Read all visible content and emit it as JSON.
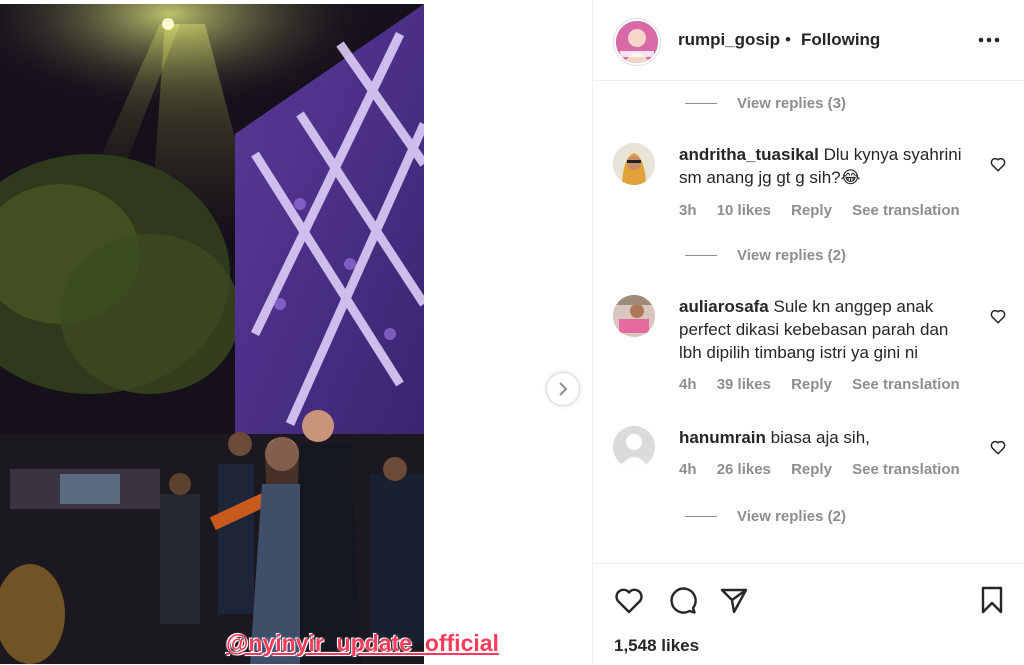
{
  "post": {
    "watermark": "@nyinyir_update_official"
  },
  "header": {
    "username": "rumpi_gosip",
    "separator": "•",
    "follow_status": "Following",
    "more_icon": "more-horizontal-icon"
  },
  "comments": {
    "view_replies": [
      {
        "label": "View replies (3)"
      },
      {
        "label": "View replies (2)"
      },
      {
        "label": "View replies (2)"
      }
    ],
    "items": [
      {
        "username": "andritha_tuasikal",
        "text": "Dlu kynya syahrini sm anang jg gt g sih?😂",
        "time": "3h",
        "likes": "10 likes",
        "reply": "Reply",
        "translation": "See translation"
      },
      {
        "username": "auliarosafa",
        "text": "Sule kn anggep anak perfect dikasi kebebasan parah dan lbh dipilih timbang istri ya gini ni",
        "time": "4h",
        "likes": "39 likes",
        "reply": "Reply",
        "translation": "See translation"
      },
      {
        "username": "hanumrain",
        "text": "biasa aja sih,",
        "time": "4h",
        "likes": "26 likes",
        "reply": "Reply",
        "translation": "See translation"
      }
    ]
  },
  "footer": {
    "likes": "1,548 likes",
    "icons": [
      "heart-icon",
      "comment-icon",
      "share-icon",
      "bookmark-icon"
    ]
  }
}
